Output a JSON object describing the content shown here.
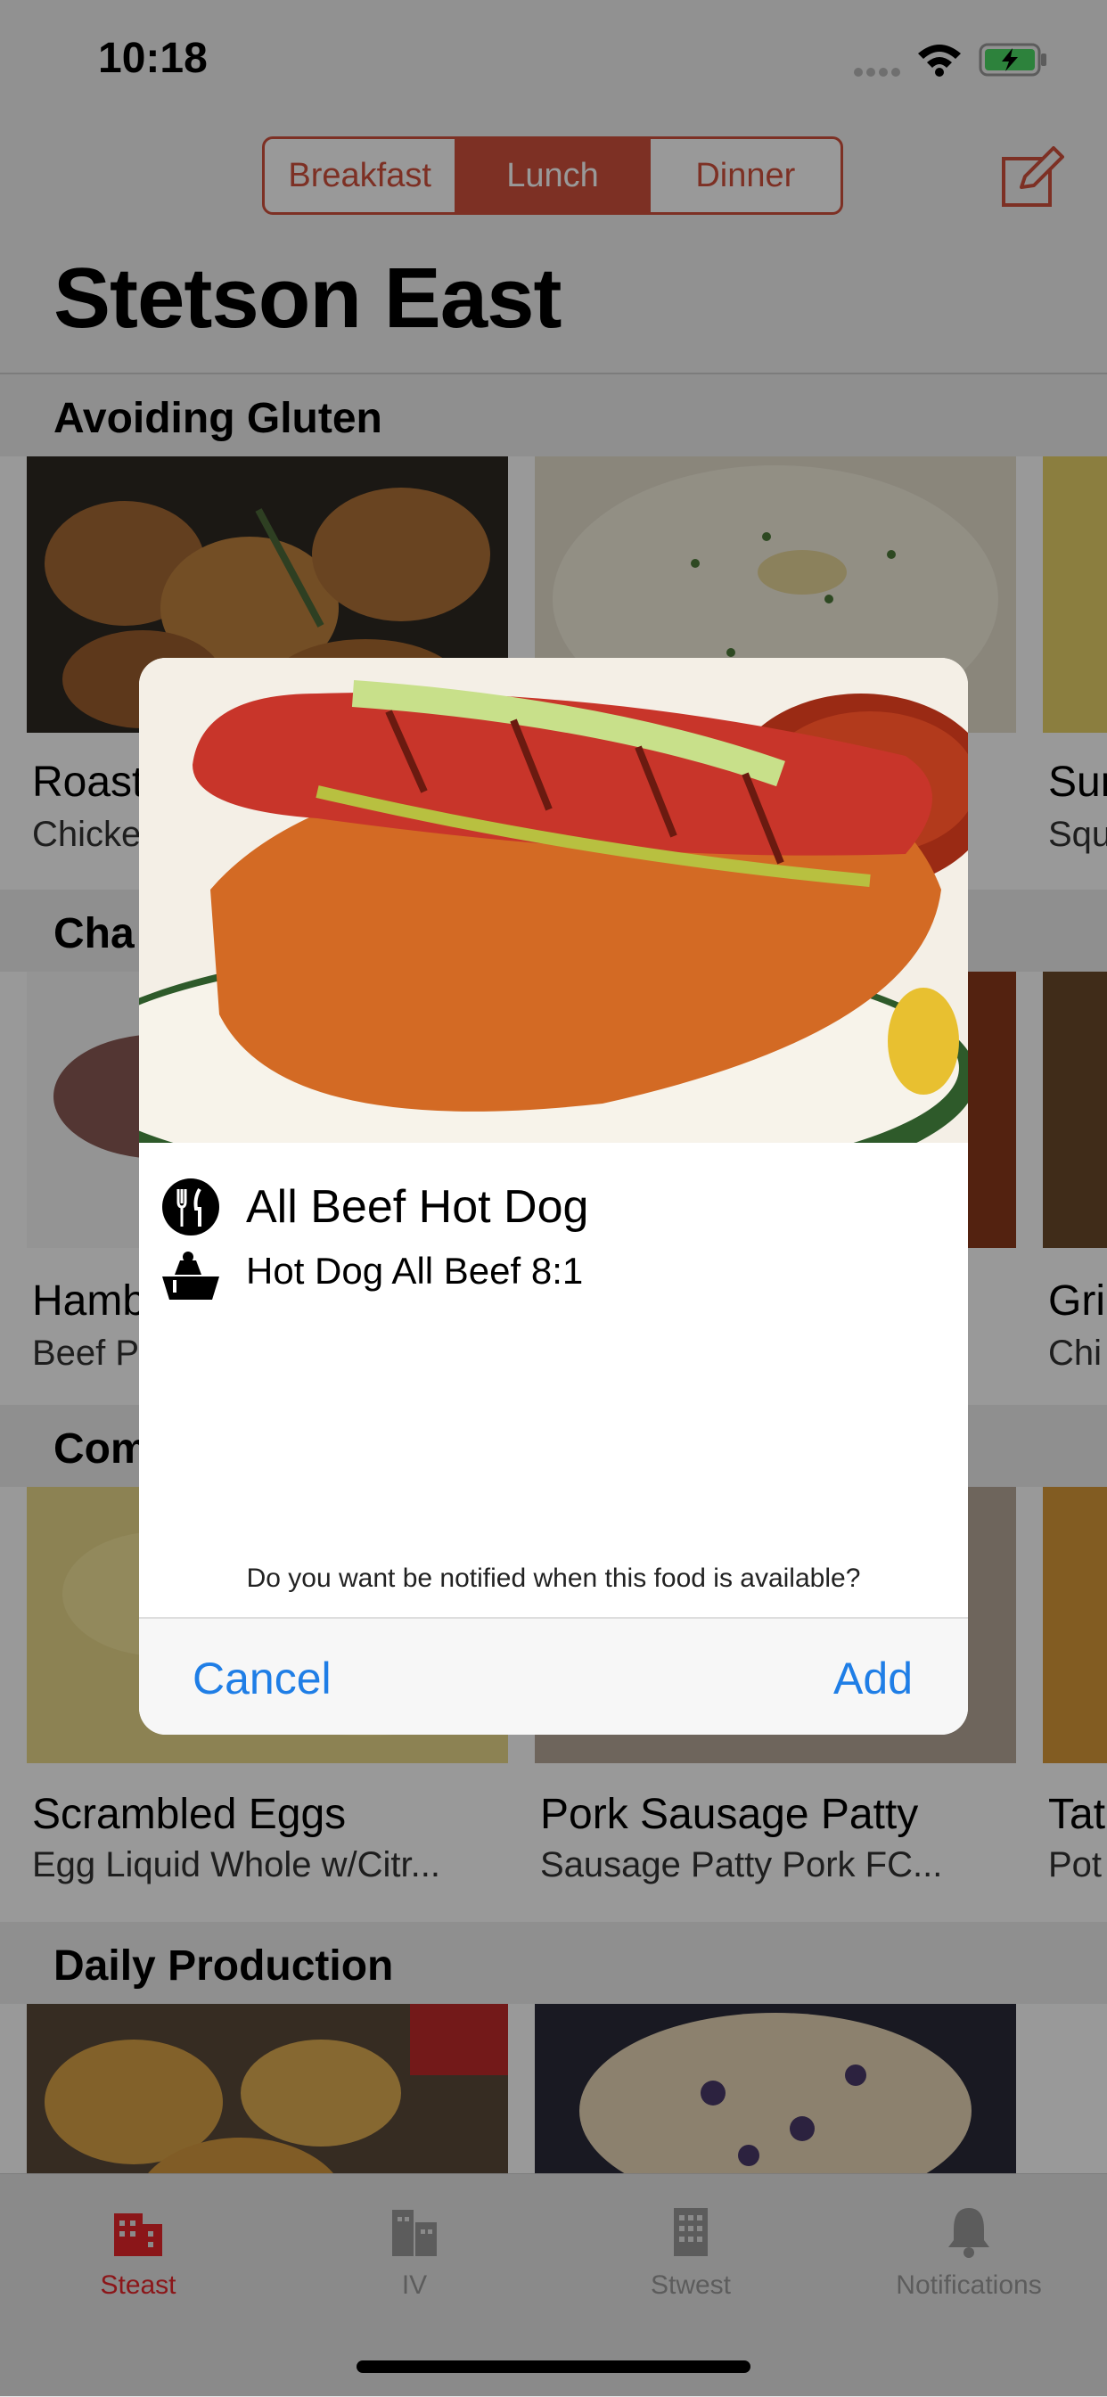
{
  "status_bar": {
    "time": "10:18"
  },
  "header": {
    "meals": [
      "Breakfast",
      "Lunch",
      "Dinner"
    ],
    "selected_meal": "Lunch",
    "title": "Stetson East"
  },
  "sections": [
    {
      "title": "Avoiding Gluten",
      "title_visible": "Avoiding Gluten",
      "items": [
        {
          "name": "Roast",
          "sub": "Chicke"
        },
        {
          "name": "",
          "sub": ""
        },
        {
          "name": "Sur",
          "sub": "Squ"
        }
      ]
    },
    {
      "title": "Cha",
      "items": [
        {
          "name": "Hamb",
          "sub": "Beef P"
        },
        {
          "name": "",
          "sub": ""
        },
        {
          "name": "Gri",
          "sub": "Chi"
        }
      ]
    },
    {
      "title": "Com",
      "items": [
        {
          "name": "Scrambled Eggs",
          "sub": "Egg Liquid Whole w/Citr..."
        },
        {
          "name": "Pork Sausage Patty",
          "sub": "Sausage Patty Pork FC..."
        },
        {
          "name": "Tat",
          "sub": "Pot"
        }
      ]
    },
    {
      "title": "Daily Production",
      "items": []
    }
  ],
  "dialog": {
    "food_name": "All Beef Hot Dog",
    "food_detail": "Hot Dog All Beef 8:1",
    "question": "Do you want be notified when this food is available?",
    "cancel_label": "Cancel",
    "add_label": "Add"
  },
  "tabbar": {
    "tabs": [
      {
        "label": "Steast",
        "icon": "building-icon",
        "active": true
      },
      {
        "label": "IV",
        "icon": "buildings-icon",
        "active": false
      },
      {
        "label": "Stwest",
        "icon": "office-building-icon",
        "active": false
      },
      {
        "label": "Notifications",
        "icon": "bell-icon",
        "active": false
      }
    ]
  },
  "colors": {
    "accent": "#d0503c",
    "action_blue": "#1f7ee6",
    "tab_active": "#e8262a",
    "tab_inactive": "#9a9a9a"
  }
}
